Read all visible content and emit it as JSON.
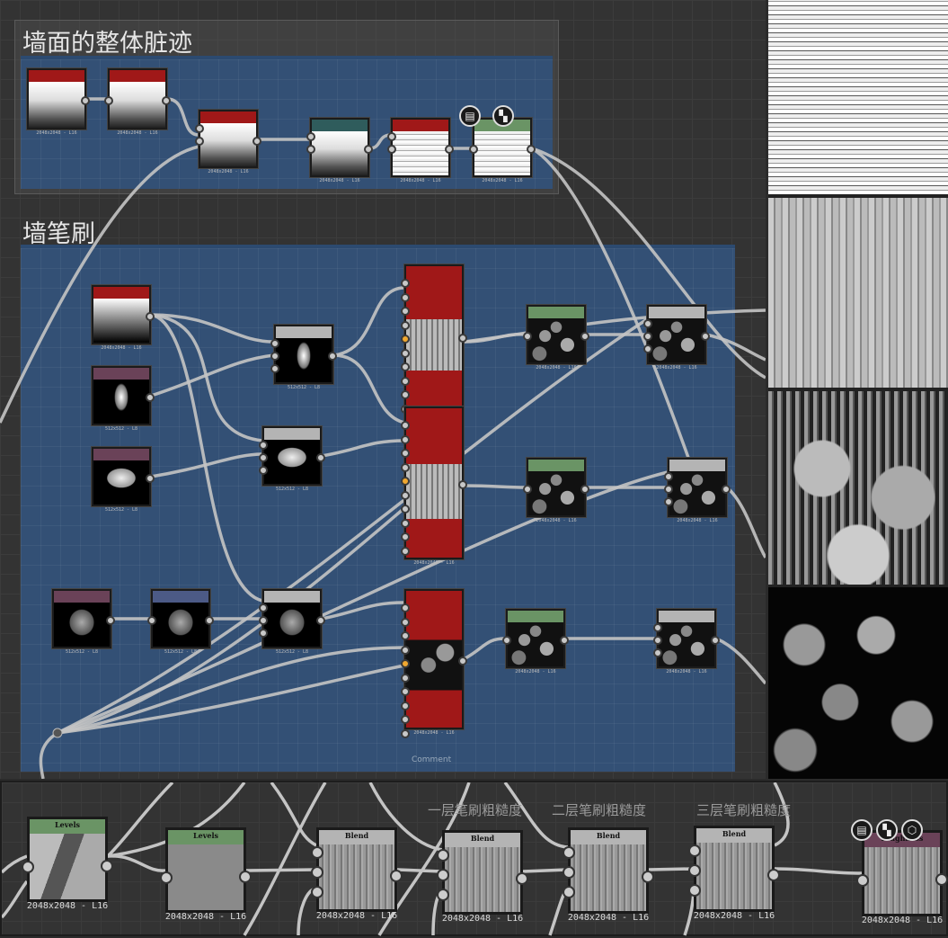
{
  "frames": {
    "top_title": "墙面的整体脏迹",
    "brush_title": "墙笔刷",
    "comment": "Comment"
  },
  "sizes": {
    "large": "2048x2048 - L16",
    "small": "512x512 - L8"
  },
  "bottom": {
    "notes": [
      "一层笔刷粗糙度",
      "二层笔刷粗糙度",
      "三层笔刷粗糙度"
    ],
    "nodes": [
      {
        "title": "Levels",
        "size": "2048x2048 - L16"
      },
      {
        "title": "Levels",
        "size": "2048x2048 - L16"
      },
      {
        "title": "Blend",
        "size": "2048x2048 - L16"
      },
      {
        "title": "Blend",
        "size": "2048x2048 - L16"
      },
      {
        "title": "Blend",
        "size": "2048x2048 - L16"
      },
      {
        "title": "Blend",
        "size": "2048x2048 - L16"
      },
      {
        "title": "roughness",
        "size": "2048x2048 - L16"
      }
    ]
  },
  "icons": [
    "document-icon",
    "checker-icon",
    "cube-icon"
  ],
  "colors": {
    "frame": "#335075",
    "red": "#a01818",
    "green": "#6a9465",
    "teal": "#2f5c5c",
    "purple": "#6a4258",
    "blue": "#4c5a86",
    "gray": "#b4b4b4",
    "wire": "#c4c4c4"
  }
}
